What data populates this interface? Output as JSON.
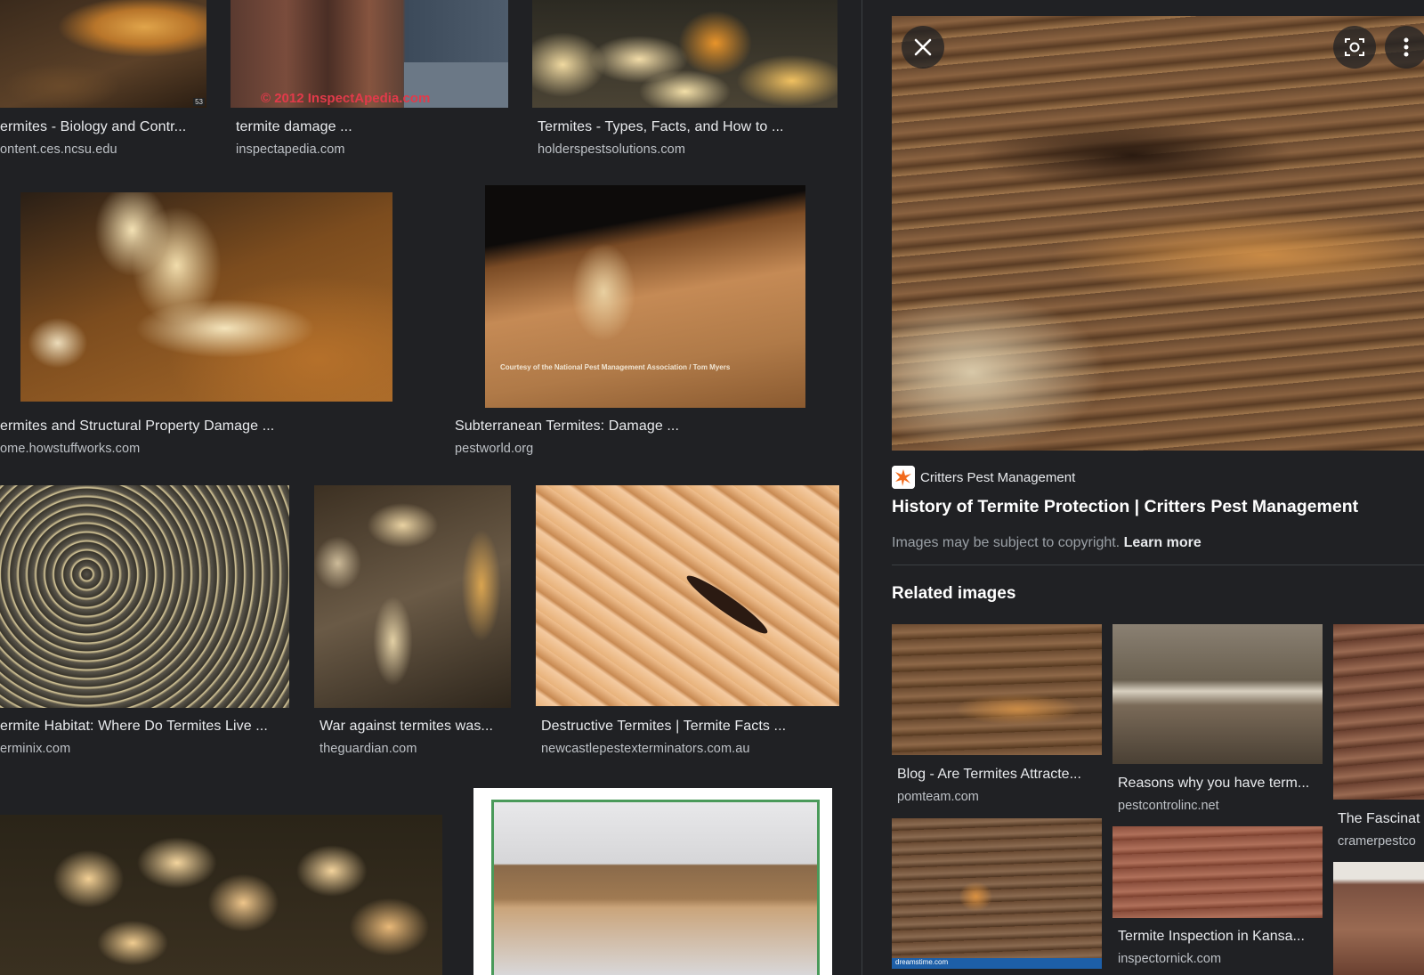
{
  "results": [
    {
      "caption": "ermites - Biology and Contr...",
      "source": "ontent.ces.ncsu.edu",
      "badge": "53"
    },
    {
      "caption": "termite damage ...",
      "source": "inspectapedia.com",
      "watermark": "© 2012 InspectApedia.com"
    },
    {
      "caption": "Termites - Types, Facts, and How to ...",
      "source": "holderspestsolutions.com"
    },
    {
      "caption": "ermites and Structural Property Damage ...",
      "source": "ome.howstuffworks.com"
    },
    {
      "caption": "Subterranean Termites: Damage ...",
      "source": "pestworld.org",
      "watermark": "Courtesy of the National Pest Management Association / Tom Myers"
    },
    {
      "caption": "ermite Habitat: Where Do Termites Live ...",
      "source": "erminix.com"
    },
    {
      "caption": "War against termites was...",
      "source": "theguardian.com"
    },
    {
      "caption": "Destructive Termites | Termite Facts ...",
      "source": "newcastlepestexterminators.com.au"
    }
  ],
  "preview": {
    "site_name": "Critters Pest Management",
    "title": "History of Termite Protection | Critters Pest Management",
    "copyright_text": "Images may be subject to copyright.",
    "learn_more": "Learn more",
    "related_heading": "Related images"
  },
  "related": [
    {
      "caption": "Blog - Are Termites Attracte...",
      "source": "pomteam.com"
    },
    {
      "caption": "Reasons why you have term...",
      "source": "pestcontrolinc.net"
    },
    {
      "caption": "The Fascinat",
      "source": "cramerpestco"
    },
    {
      "caption": "",
      "source": "",
      "watermark": "dreamstime.com"
    },
    {
      "caption": "Termite Inspection in Kansa...",
      "source": "inspectornick.com"
    }
  ],
  "icons": {
    "close": "close-icon",
    "lens": "lens-icon",
    "more": "more-vert-icon"
  }
}
